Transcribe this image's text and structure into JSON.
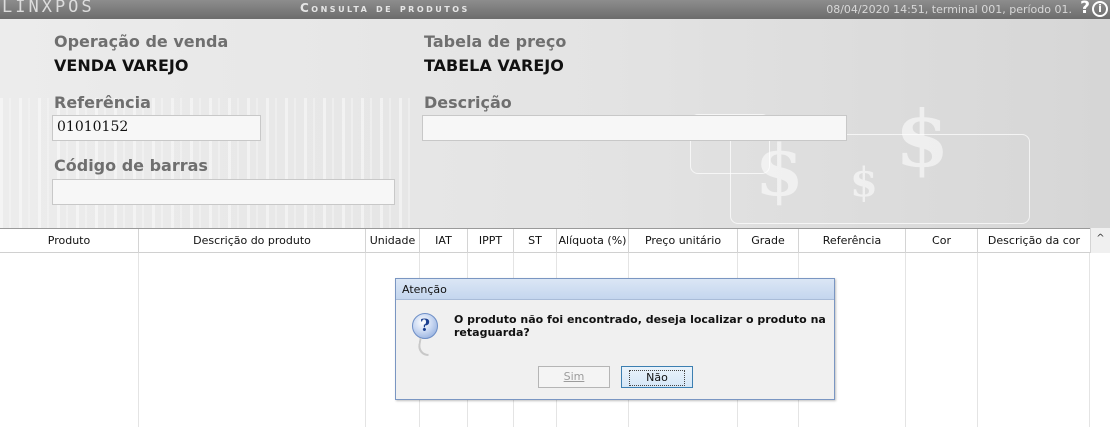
{
  "titlebar": {
    "brand": "LINXPOS",
    "title": "Consulta de produtos",
    "status": "08/04/2020 14:51, terminal 001, período 01.",
    "help_icon": "question-mark-icon",
    "info_icon": "info-icon"
  },
  "form": {
    "operacao_label": "Operação de venda",
    "operacao_value": "VENDA VAREJO",
    "tabela_label": "Tabela de preço",
    "tabela_value": "TABELA VAREJO",
    "referencia_label": "Referência",
    "referencia_value": "01010152",
    "descricao_label": "Descrição",
    "descricao_value": "",
    "codigo_label": "Código de barras",
    "codigo_value": ""
  },
  "table": {
    "columns": [
      "Produto",
      "Descrição do produto",
      "Unidade",
      "IAT",
      "IPPT",
      "ST",
      "Alíquota (%)",
      "Preço unitário",
      "Grade",
      "Referência",
      "Cor",
      "Descrição da cor"
    ]
  },
  "dialog": {
    "title": "Atenção",
    "message": "O produto não foi encontrado, deseja localizar o produto na retaguarda?",
    "icon": "question-icon",
    "yes_label": "Sim",
    "no_label": "Não"
  },
  "colors": {
    "titlebar": "#7a7a7a",
    "dialog_border": "#7a96c2",
    "focus_button": "#3c7fb1"
  }
}
